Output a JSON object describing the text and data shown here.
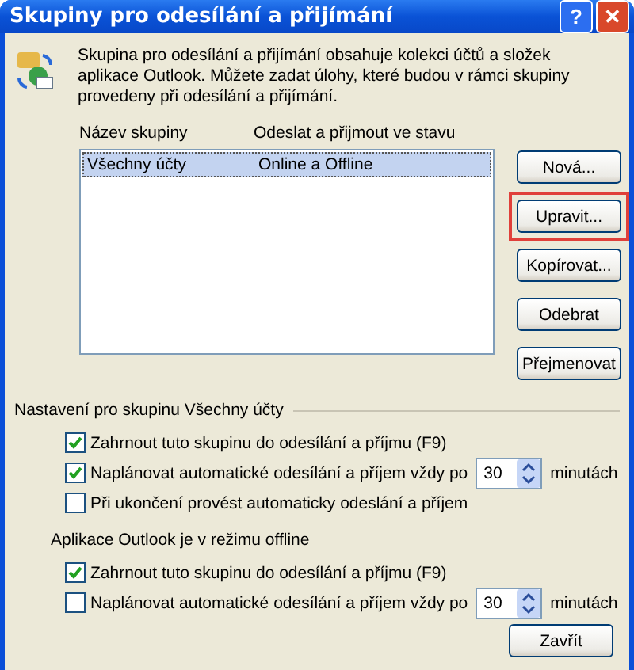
{
  "window": {
    "title": "Skupiny pro odesílání a přijímání",
    "buttons": [
      {
        "kind": "help",
        "label": "?"
      },
      {
        "kind": "close",
        "label": "✕"
      }
    ]
  },
  "description": "Skupina pro odesílání a přijímání obsahuje kolekci účtů a složek aplikace Outlook. Můžete zadat úlohy, které budou v rámci skupiny provedeny při odesílání a přijímání.",
  "table": {
    "columns": [
      "Název skupiny",
      "Odeslat a přijmout ve stavu"
    ],
    "rows": [
      {
        "cells": [
          "Všechny účty",
          "Online a Offline"
        ],
        "selected": true
      }
    ]
  },
  "side_buttons": [
    {
      "label": "Nová...",
      "highlighted": false
    },
    {
      "label": "Upravit...",
      "highlighted": true
    },
    {
      "label": "Kopírovat...",
      "highlighted": false
    },
    {
      "label": "Odebrat",
      "highlighted": false
    },
    {
      "label": "Přejmenovat",
      "highlighted": false
    }
  ],
  "sections": [
    {
      "title": "Nastavení pro skupinu Všechny účty",
      "kind": "group",
      "options": [
        {
          "kind": "checkbox",
          "label": "Zahrnout tuto skupinu do odesílání a příjmu (F9)",
          "checked": true
        },
        {
          "kind": "spin",
          "label": "Naplánovat automatické odesílání a příjem vždy po",
          "checked": true,
          "value": "30",
          "unit": "minutách"
        },
        {
          "kind": "checkbox",
          "label": "Při ukončení provést automaticky odeslání a příjem",
          "checked": false
        }
      ]
    },
    {
      "title": "Aplikace Outlook je v režimu offline",
      "kind": "sub",
      "options": [
        {
          "kind": "checkbox",
          "label": "Zahrnout tuto skupinu do odesílání a příjmu (F9)",
          "checked": true
        },
        {
          "kind": "spin",
          "label": "Naplánovat automatické odesílání a příjem vždy po",
          "checked": false,
          "value": "30",
          "unit": "minutách"
        }
      ]
    }
  ],
  "footer_button": "Zavřít"
}
